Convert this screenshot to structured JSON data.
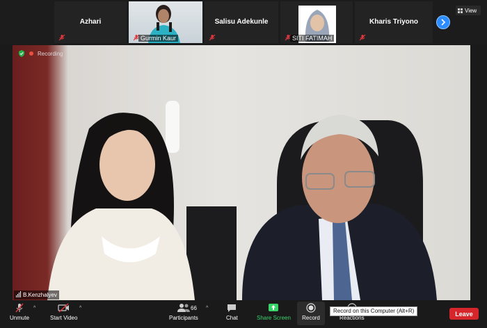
{
  "gallery": {
    "participants": [
      {
        "name": "Azhari",
        "video": false
      },
      {
        "name": "Gurmin Kaur",
        "video": true
      },
      {
        "name": "Salisu Adekunle",
        "video": false
      },
      {
        "name": "SITI FATIMAH",
        "video": true
      },
      {
        "name": "Kharis Triyono",
        "video": false
      }
    ],
    "view_label": "View"
  },
  "main_video": {
    "recording_label": "Recording",
    "speaker_name": "B.Kenzhalyev"
  },
  "toolbar": {
    "unmute": "Unmute",
    "start_video": "Start Video",
    "participants": "Participants",
    "participants_count": "66",
    "chat": "Chat",
    "share_screen": "Share Screen",
    "record": "Record",
    "reactions": "Reactions",
    "leave": "Leave",
    "record_tooltip": "Record on this Computer (Alt+R)"
  },
  "colors": {
    "accent_blue": "#2d8cff",
    "share_green": "#3ad36a",
    "leave_red": "#d6252b",
    "mute_red": "#e0383e"
  }
}
